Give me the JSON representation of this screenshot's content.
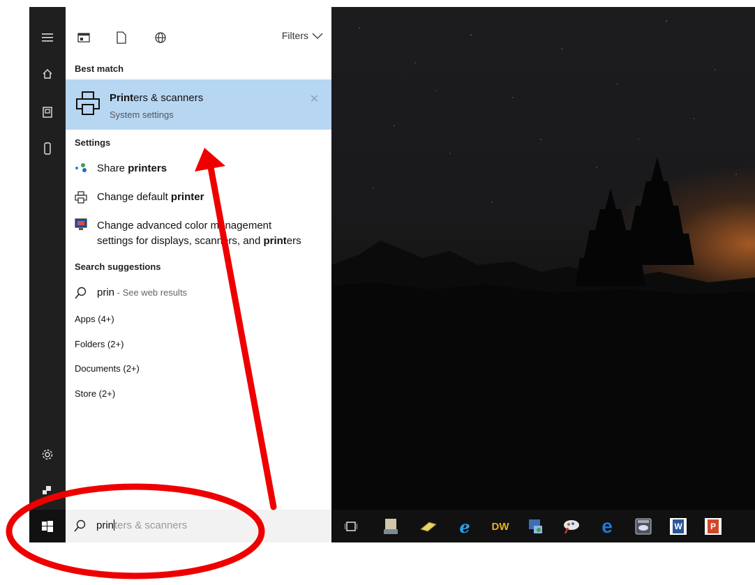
{
  "search_panel": {
    "filters_label": "Filters",
    "best_match_heading": "Best match",
    "best_match": {
      "title_bold": "Print",
      "title_rest": "ers & scanners",
      "subtitle": "System settings"
    },
    "settings_heading": "Settings",
    "settings_items": [
      {
        "prefix": "Share ",
        "bold": "printers",
        "suffix": ""
      },
      {
        "prefix": "Change default ",
        "bold": "printer",
        "suffix": ""
      },
      {
        "prefix": "Change advanced color management",
        "line2_prefix": "settings for displays, scanners, and ",
        "bold": "print",
        "suffix": "ers"
      }
    ],
    "suggestions_heading": "Search suggestions",
    "suggestion": {
      "query": "prin",
      "hint": " - See web results"
    },
    "categories": [
      "Apps (4+)",
      "Folders (2+)",
      "Documents (2+)",
      "Store (2+)"
    ]
  },
  "taskbar": {
    "search_typed": "prin",
    "search_rest": "ters & scanners",
    "apps": [
      "task-view",
      "file-app",
      "eraser-app",
      "internet-explorer",
      "dreamweaver",
      "network-app",
      "paint-app",
      "edge",
      "control-app",
      "word",
      "powerpoint"
    ],
    "dreamweaver_label": "DW",
    "word_label": "W",
    "powerpoint_label": "P"
  },
  "annotation_color": "#ee0000"
}
